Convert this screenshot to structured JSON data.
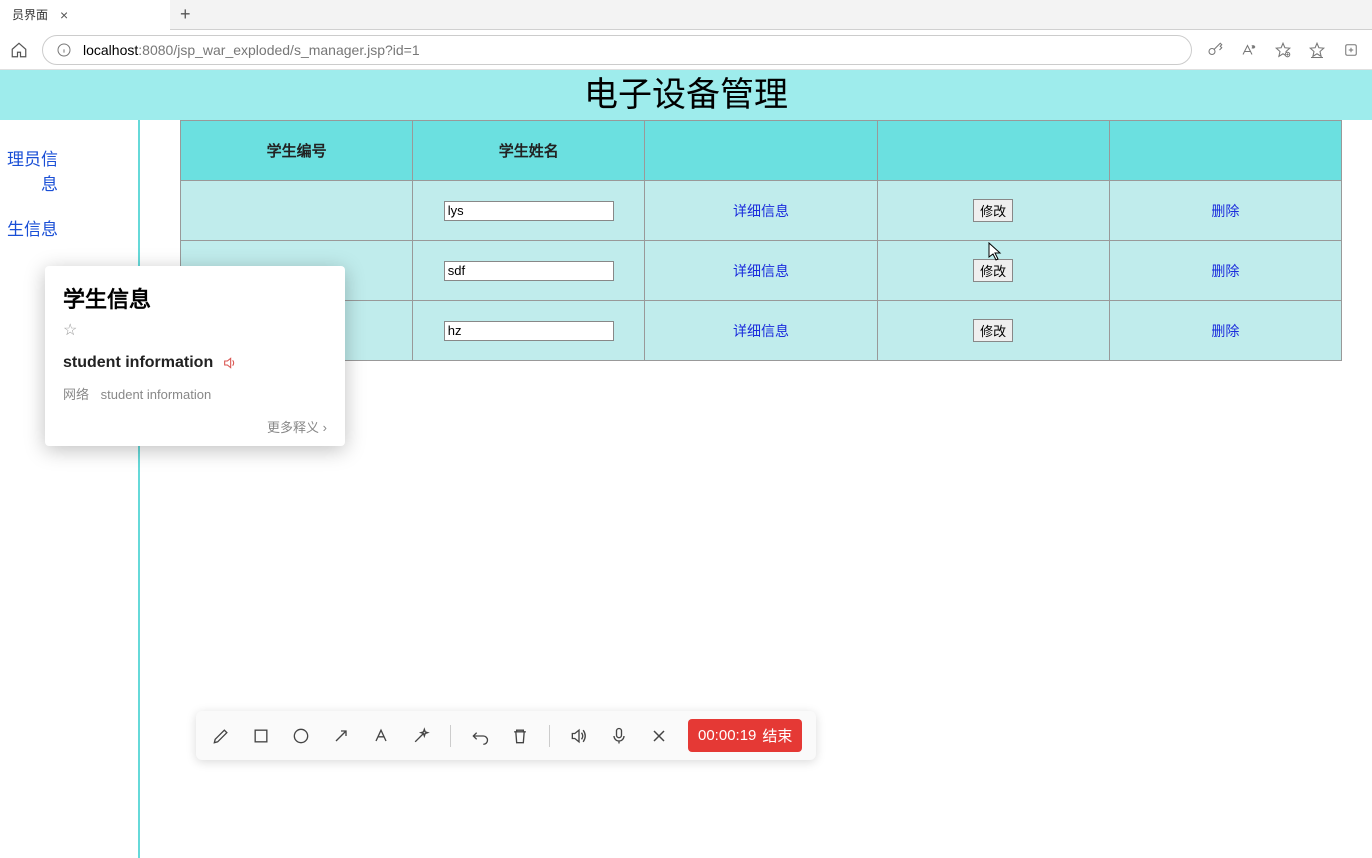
{
  "browser": {
    "tab_title": "员界面",
    "url_host": "localhost",
    "url_port": ":8080",
    "url_path": "/jsp_war_exploded/s_manager.jsp?id=1"
  },
  "page": {
    "title": "电子设备管理"
  },
  "sidebar": {
    "items": [
      {
        "label": "理员信息"
      },
      {
        "label": "生信息"
      }
    ]
  },
  "table": {
    "headers": {
      "id": "学生编号",
      "name": "学生姓名",
      "detail": "",
      "edit": "",
      "del": ""
    },
    "detail_label": "详细信息",
    "edit_label": "修改",
    "del_label": "删除",
    "rows": [
      {
        "name": "lys"
      },
      {
        "name": "sdf"
      },
      {
        "name": "hz"
      }
    ]
  },
  "dict": {
    "word": "学生信息",
    "en": "student information",
    "src_label": "网络",
    "src_text": "student information",
    "more": "更多释义"
  },
  "recorder": {
    "time": "00:00:19",
    "end": "结束"
  }
}
